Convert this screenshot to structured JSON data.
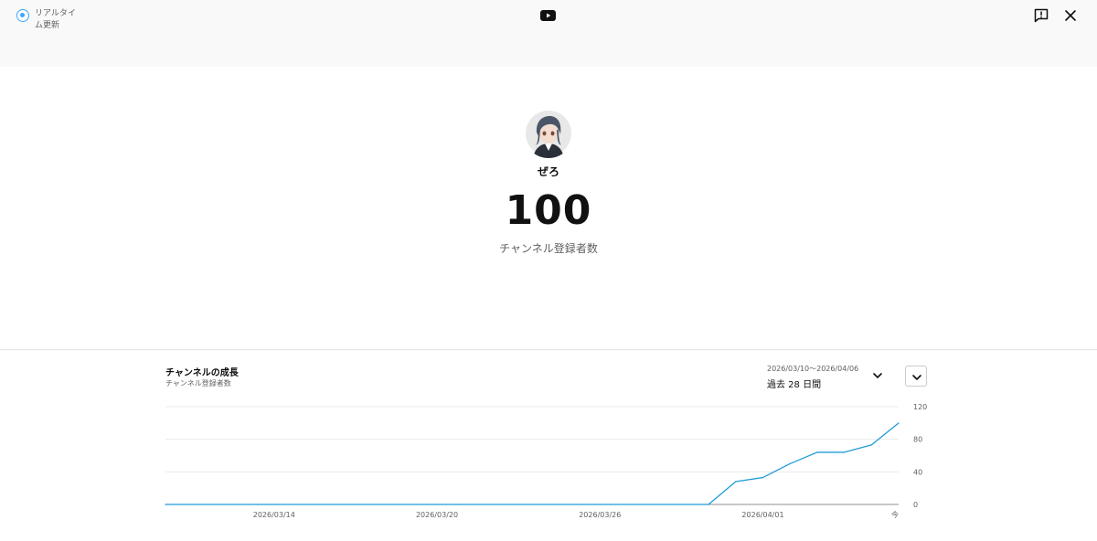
{
  "header": {
    "realtime_label": "リアルタイム更新",
    "logo_icon": "youtube-icon",
    "feedback_icon": "feedback-icon",
    "close_icon": "close-icon"
  },
  "channel": {
    "name": "ぜろ",
    "subscriber_count": "100",
    "subscriber_label": "チャンネル登録者数"
  },
  "growth": {
    "title": "チャンネルの成長",
    "subtitle": "チャンネル登録者数",
    "date_range": "2026/03/10〜2026/04/06",
    "period_label": "過去 28 日間"
  },
  "colors": {
    "accent": "#3ea6ff",
    "line": "#1f9cd6",
    "grid": "#e5e5e5",
    "logo_red": "#111111"
  },
  "chart_data": {
    "type": "line",
    "title": "",
    "xlabel": "",
    "ylabel": "",
    "x_ticks": [
      "2026/03/14",
      "2026/03/20",
      "2026/03/26",
      "2026/04/01",
      "今"
    ],
    "x_tick_days": [
      4,
      10,
      16,
      22,
      27
    ],
    "y_ticks": [
      0,
      40,
      80,
      120
    ],
    "ylim": [
      0,
      120
    ],
    "xlim": [
      0,
      27
    ],
    "grid": true,
    "series": [
      {
        "name": "",
        "x_days": [
          0,
          20,
          21,
          22,
          23,
          24,
          25,
          26,
          27
        ],
        "values": [
          0,
          0,
          28,
          33,
          50,
          64,
          64,
          73,
          100
        ]
      }
    ]
  }
}
